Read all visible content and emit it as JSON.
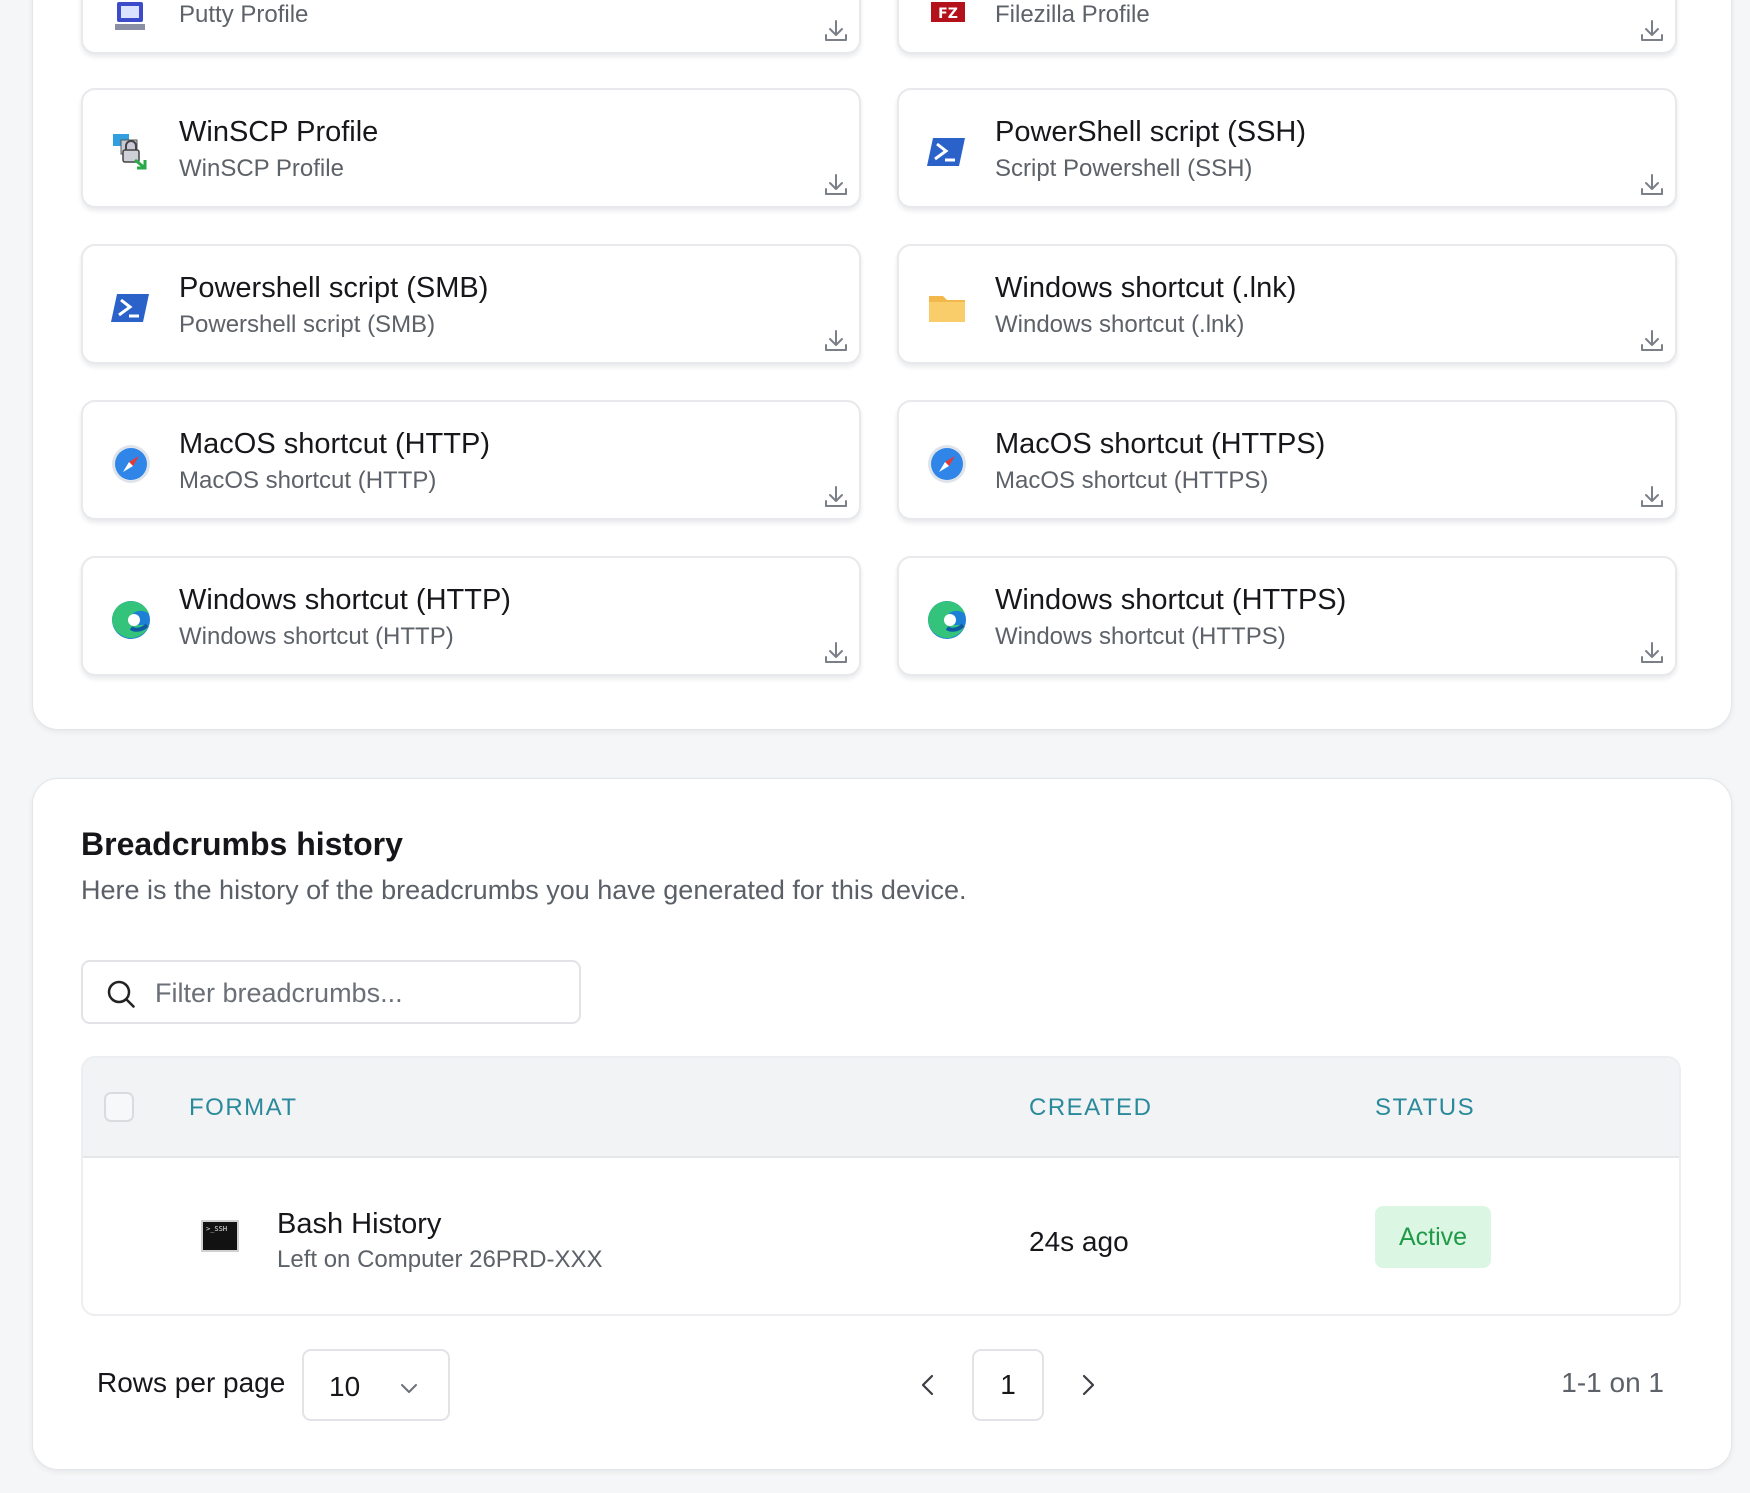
{
  "profiles": [
    {
      "title": "",
      "subtitle": "Putty Profile",
      "icon": "putty-icon"
    },
    {
      "title": "",
      "subtitle": "Filezilla Profile",
      "icon": "filezilla-icon"
    },
    {
      "title": "WinSCP Profile",
      "subtitle": "WinSCP Profile",
      "icon": "winscp-icon"
    },
    {
      "title": "PowerShell script (SSH)",
      "subtitle": "Script Powershell (SSH)",
      "icon": "powershell-icon"
    },
    {
      "title": "Powershell script (SMB)",
      "subtitle": "Powershell script (SMB)",
      "icon": "powershell-icon"
    },
    {
      "title": "Windows shortcut (.lnk)",
      "subtitle": "Windows shortcut (.lnk)",
      "icon": "folder-icon"
    },
    {
      "title": "MacOS shortcut (HTTP)",
      "subtitle": "MacOS shortcut (HTTP)",
      "icon": "safari-icon"
    },
    {
      "title": "MacOS shortcut (HTTPS)",
      "subtitle": "MacOS shortcut (HTTPS)",
      "icon": "safari-icon"
    },
    {
      "title": "Windows shortcut (HTTP)",
      "subtitle": "Windows shortcut (HTTP)",
      "icon": "edge-icon"
    },
    {
      "title": "Windows shortcut (HTTPS)",
      "subtitle": "Windows shortcut (HTTPS)",
      "icon": "edge-icon"
    }
  ],
  "breadcrumbs": {
    "title": "Breadcrumbs history",
    "description": "Here is the history of the breadcrumbs you have generated for this device.",
    "search": {
      "placeholder": "Filter breadcrumbs...",
      "value": ""
    },
    "table": {
      "headers": {
        "format": "FORMAT",
        "created": "CREATED",
        "status": "STATUS"
      },
      "rows": [
        {
          "format_title": "Bash History",
          "format_subtitle": "Left on Computer 26PRD-XXX",
          "icon": "terminal-ssh-icon",
          "icon_text": ">_SSH",
          "created": "24s ago",
          "status": "Active"
        }
      ]
    },
    "pagination": {
      "rows_per_page_label": "Rows per page",
      "rows_per_page": "10",
      "current_page": "1",
      "range": "1-1 on 1"
    }
  },
  "colors": {
    "accent": "#2a8a9c",
    "status_active_bg": "#dcf6e4",
    "status_active_text": "#1f9a47"
  }
}
